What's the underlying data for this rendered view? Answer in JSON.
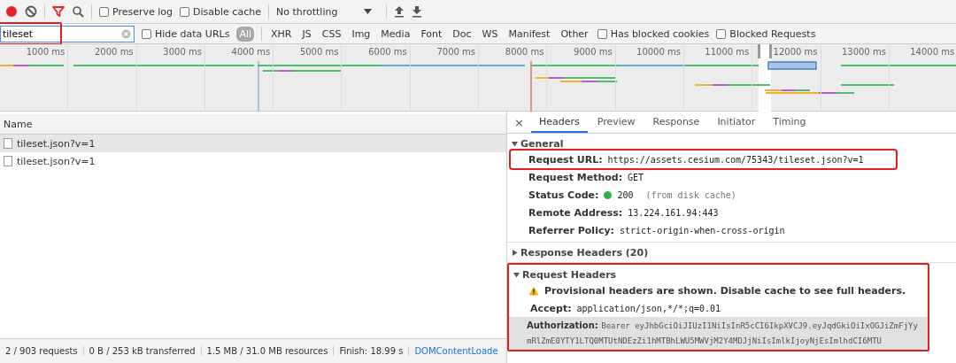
{
  "toolbar": {
    "recording": true,
    "filter_active": true,
    "checkboxes": [
      {
        "label": "Preserve log",
        "checked": false
      },
      {
        "label": "Disable cache",
        "checked": false
      }
    ],
    "throttling": "No throttling"
  },
  "filter_bar": {
    "value": "tileset",
    "highlighted": true,
    "hide_data_urls": {
      "label": "Hide data URLs",
      "checked": false
    },
    "types": [
      {
        "label": "All",
        "selected": true
      },
      {
        "label": "XHR",
        "selected": false
      },
      {
        "label": "JS",
        "selected": false
      },
      {
        "label": "CSS",
        "selected": false
      },
      {
        "label": "Img",
        "selected": false
      },
      {
        "label": "Media",
        "selected": false
      },
      {
        "label": "Font",
        "selected": false
      },
      {
        "label": "Doc",
        "selected": false
      },
      {
        "label": "WS",
        "selected": false
      },
      {
        "label": "Manifest",
        "selected": false
      },
      {
        "label": "Other",
        "selected": false
      }
    ],
    "checkboxes": [
      {
        "label": "Has blocked cookies",
        "checked": false
      },
      {
        "label": "Blocked Requests",
        "checked": false
      }
    ]
  },
  "timeline": {
    "ticks": [
      "1000 ms",
      "2000 ms",
      "3000 ms",
      "4000 ms",
      "5000 ms",
      "6000 ms",
      "7000 ms",
      "8000 ms",
      "9000 ms",
      "10000 ms",
      "11000 ms",
      "12000 ms",
      "13000 ms",
      "14000 ms"
    ]
  },
  "requests": {
    "column": "Name",
    "rows": [
      {
        "name": "tileset.json?v=1",
        "selected": true
      },
      {
        "name": "tileset.json?v=1",
        "selected": false
      }
    ]
  },
  "status_bar": [
    {
      "kind": "text",
      "text": "2 / 903 requests"
    },
    {
      "kind": "text",
      "text": "0 B / 253 kB transferred"
    },
    {
      "kind": "text",
      "text": "1.5 MB / 31.0 MB resources"
    },
    {
      "kind": "text",
      "text": "Finish: 18.99 s"
    },
    {
      "kind": "link",
      "text": "DOMContentLoade"
    }
  ],
  "details": {
    "close": "×",
    "tabs": [
      {
        "label": "Headers",
        "selected": true
      },
      {
        "label": "Preview",
        "selected": false
      },
      {
        "label": "Response",
        "selected": false
      },
      {
        "label": "Initiator",
        "selected": false
      },
      {
        "label": "Timing",
        "selected": false
      }
    ],
    "sections": [
      {
        "title": "General",
        "expanded": true,
        "rows": [
          {
            "kind": "field",
            "label": "Request URL:",
            "value": "https://assets.cesium.com/75343/tileset.json?v=1",
            "highlighted": true
          },
          {
            "kind": "field",
            "label": "Request Method:",
            "value": "GET"
          },
          {
            "kind": "status",
            "label": "Status Code:",
            "value": "200",
            "note": "(from disk cache)"
          },
          {
            "kind": "field",
            "label": "Remote Address:",
            "value": "13.224.161.94:443"
          },
          {
            "kind": "field",
            "label": "Referrer Policy:",
            "value": "strict-origin-when-cross-origin"
          }
        ]
      },
      {
        "title": "Response Headers (20)",
        "expanded": false
      },
      {
        "title": "Request Headers",
        "expanded": true,
        "highlighted": true,
        "rows": [
          {
            "kind": "warning",
            "text": "Provisional headers are shown. Disable cache to see full headers."
          },
          {
            "kind": "field",
            "label": "Accept:",
            "value": "application/json,*/*;q=0.01"
          },
          {
            "kind": "long",
            "label": "Authorization:",
            "value": "Bearer eyJhbGciOiJIUzI1NiIsInR5cCI6IkpXVCJ9.eyJqdGkiOiIxOGJiZmFjYy",
            "value_2": "mRlZmE0YTY1LTQ0MTUtNDEzZi1hMTBhLWU5MWVjM2Y4MDJjNiIsImlkIjoyNjEsImlhdCI6MTU"
          }
        ]
      }
    ]
  }
}
